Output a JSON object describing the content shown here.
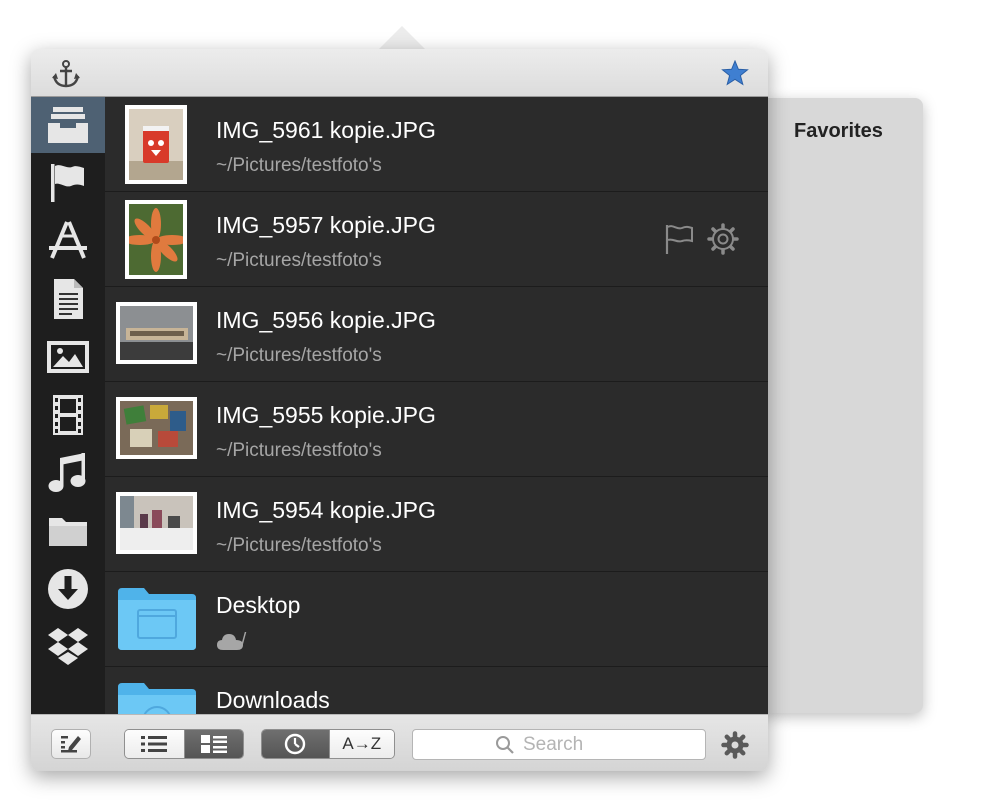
{
  "favorites_panel": {
    "title": "Favorites"
  },
  "titlebar": {
    "left_icon": "anchor-icon",
    "right_icon": "star-icon"
  },
  "sidebar": {
    "items": [
      {
        "icon": "inbox-tray-icon",
        "selected": true
      },
      {
        "icon": "flag-icon"
      },
      {
        "icon": "app-store-icon"
      },
      {
        "icon": "document-icon"
      },
      {
        "icon": "picture-icon"
      },
      {
        "icon": "film-icon"
      },
      {
        "icon": "music-note-icon"
      },
      {
        "icon": "folder-icon"
      },
      {
        "icon": "download-icon"
      },
      {
        "icon": "dropbox-icon"
      }
    ]
  },
  "files": [
    {
      "name": "IMG_5961 kopie.JPG",
      "path": "~/Pictures/testfoto's"
    },
    {
      "name": "IMG_5957 kopie.JPG",
      "path": "~/Pictures/testfoto's"
    },
    {
      "name": "IMG_5956 kopie.JPG",
      "path": "~/Pictures/testfoto's"
    },
    {
      "name": "IMG_5955 kopie.JPG",
      "path": "~/Pictures/testfoto's"
    },
    {
      "name": "IMG_5954 kopie.JPG",
      "path": "~/Pictures/testfoto's"
    },
    {
      "name": "Desktop",
      "path": "/"
    },
    {
      "name": "Downloads",
      "path": ""
    }
  ],
  "bottombar": {
    "sort_az_label": "A→Z",
    "search_placeholder": "Search"
  },
  "colors": {
    "sidebar_selected": "#4e6173",
    "list_background": "#2b2b2b",
    "folder_blue": "#63c3f3",
    "star_blue": "#3f7fd1"
  }
}
